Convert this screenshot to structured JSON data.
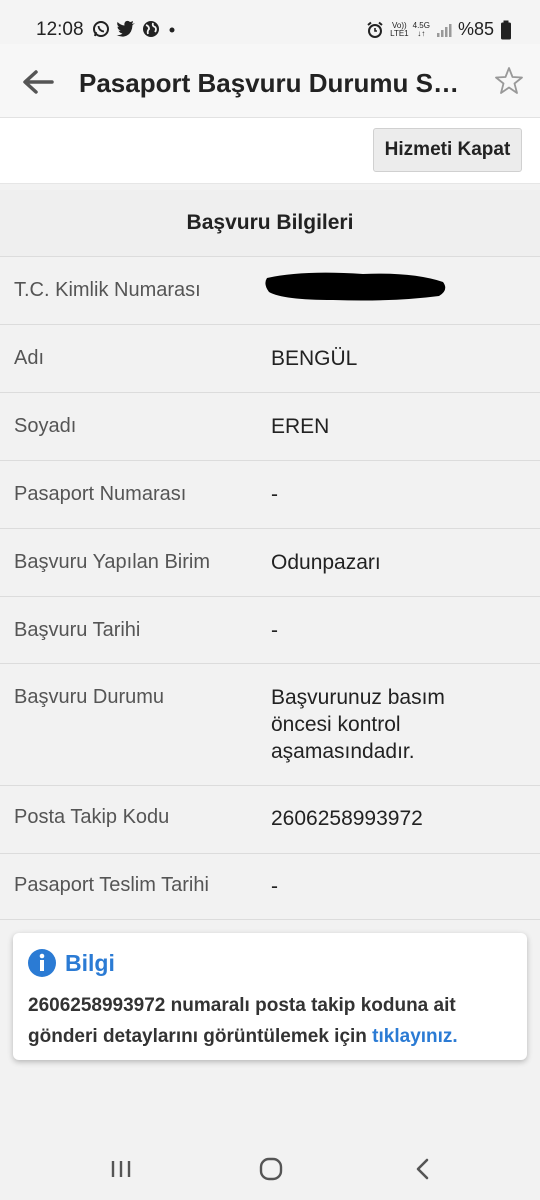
{
  "status_bar": {
    "time": "12:08",
    "battery": "%85",
    "net_top": "Vo))",
    "net_bottom": "LTE1",
    "net_gen": "4.5G",
    "icons": [
      "whatsapp-icon",
      "twitter-icon",
      "globe-icon",
      "dot-icon",
      "alarm-icon",
      "signal-icon",
      "battery-icon"
    ]
  },
  "app_bar": {
    "title": "Pasaport Başvuru Durumu Sorgulama",
    "icons": [
      "back-arrow-icon",
      "star-icon"
    ]
  },
  "toolbar": {
    "close_service_label": "Hizmeti Kapat"
  },
  "section": {
    "title": "Başvuru Bilgileri"
  },
  "rows": [
    {
      "label": "T.C. Kimlik Numarası",
      "value": ""
    },
    {
      "label": "Adı",
      "value": "BENGÜL"
    },
    {
      "label": "Soyadı",
      "value": "EREN"
    },
    {
      "label": "Pasaport Numarası",
      "value": "-"
    },
    {
      "label": "Başvuru Yapılan Birim",
      "value": "Odunpazarı"
    },
    {
      "label": "Başvuru Tarihi",
      "value": "-"
    },
    {
      "label": "Başvuru Durumu",
      "value": "Başvurunuz basım öncesi kontrol aşamasındadır."
    },
    {
      "label": "Posta Takip Kodu",
      "value": "2606258993972"
    },
    {
      "label": "Pasaport Teslim Tarihi",
      "value": "-"
    }
  ],
  "info_box": {
    "heading": "Bilgi",
    "text": "2606258993972 numaralı posta takip koduna ait gönderi detaylarını görüntülemek için ",
    "link": "tıklayınız.",
    "icon": "info-icon"
  },
  "nav_bar": {
    "icons": [
      "recents-icon",
      "home-icon",
      "back-icon"
    ]
  },
  "colors": {
    "accent": "#2b7bd4",
    "text": "#333333",
    "background": "#f2f2f2"
  }
}
